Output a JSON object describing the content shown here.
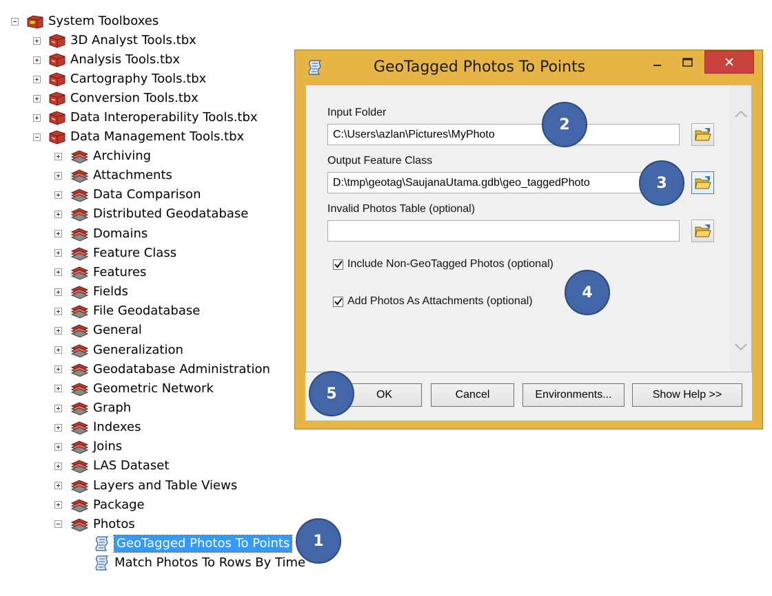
{
  "tree": {
    "root": {
      "label": "System Toolboxes",
      "expanded": true,
      "icon": "toolbox-folder-icon"
    },
    "toolboxes": [
      {
        "label": "3D Analyst Tools.tbx",
        "expanded": false
      },
      {
        "label": "Analysis Tools.tbx",
        "expanded": false
      },
      {
        "label": "Cartography Tools.tbx",
        "expanded": false
      },
      {
        "label": "Conversion Tools.tbx",
        "expanded": false
      },
      {
        "label": "Data Interoperability Tools.tbx",
        "expanded": false
      },
      {
        "label": "Data Management Tools.tbx",
        "expanded": true
      }
    ],
    "toolsets": [
      {
        "label": "Archiving",
        "expanded": false
      },
      {
        "label": "Attachments",
        "expanded": false
      },
      {
        "label": "Data Comparison",
        "expanded": false
      },
      {
        "label": "Distributed Geodatabase",
        "expanded": false
      },
      {
        "label": "Domains",
        "expanded": false
      },
      {
        "label": "Feature Class",
        "expanded": false
      },
      {
        "label": "Features",
        "expanded": false
      },
      {
        "label": "Fields",
        "expanded": false
      },
      {
        "label": "File Geodatabase",
        "expanded": false
      },
      {
        "label": "General",
        "expanded": false
      },
      {
        "label": "Generalization",
        "expanded": false
      },
      {
        "label": "Geodatabase Administration",
        "expanded": false
      },
      {
        "label": "Geometric Network",
        "expanded": false
      },
      {
        "label": "Graph",
        "expanded": false
      },
      {
        "label": "Indexes",
        "expanded": false
      },
      {
        "label": "Joins",
        "expanded": false
      },
      {
        "label": "LAS Dataset",
        "expanded": false
      },
      {
        "label": "Layers and Table Views",
        "expanded": false
      },
      {
        "label": "Package",
        "expanded": false
      },
      {
        "label": "Photos",
        "expanded": true
      }
    ],
    "tools": [
      {
        "label": "GeoTagged Photos To Points",
        "selected": true
      },
      {
        "label": "Match Photos To Rows By Time",
        "selected": false
      }
    ]
  },
  "dialog": {
    "title": "GeoTagged Photos To Points",
    "title_icon": "script-tool-icon",
    "controls": {
      "minimize": "minimize-icon",
      "maximize": "maximize-icon",
      "close": "close-icon"
    },
    "fields": [
      {
        "label": "Input Folder",
        "value": "C:\\Users\\azlan\\Pictures\\MyPhoto"
      },
      {
        "label": "Output Feature Class",
        "value": "D:\\tmp\\geotag\\SaujanaUtama.gdb\\geo_taggedPhoto"
      },
      {
        "label": "Invalid Photos Table (optional)",
        "value": ""
      }
    ],
    "checkboxes": [
      {
        "label": "Include Non-GeoTagged Photos (optional)",
        "checked": true
      },
      {
        "label": "Add Photos As Attachments (optional)",
        "checked": true
      }
    ],
    "buttons": {
      "ok": "OK",
      "cancel": "Cancel",
      "environments": "Environments...",
      "show_help": "Show Help >>"
    }
  },
  "callouts": [
    "1",
    "2",
    "3",
    "4",
    "5"
  ],
  "colors": {
    "dialog_frame": "#e6b545",
    "close_button": "#c8423b",
    "selection": "#3399ff",
    "callout": "#4366a8"
  }
}
